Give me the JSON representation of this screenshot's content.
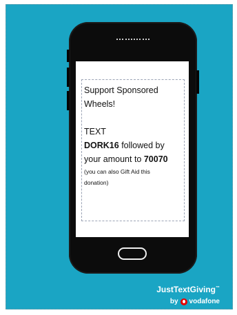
{
  "message": {
    "line1": "Support Sponsored",
    "line2": "Wheels!",
    "text_label": "TEXT",
    "code": "DORK16",
    "followed_by": " followed by",
    "amount_prefix": "your amount to ",
    "number": "70070",
    "gift_aid_1": "(you can also Gift Aid this",
    "gift_aid_2": "donation)"
  },
  "brand": {
    "name": "JustTextGiving",
    "tm": "™",
    "by": "by",
    "partner": "vodafone",
    "partner_icon": "vodafone-logo-icon"
  },
  "colors": {
    "background": "#1aa5c4",
    "phone_body": "#0c0c0c",
    "vodafone_red": "#e60000"
  }
}
